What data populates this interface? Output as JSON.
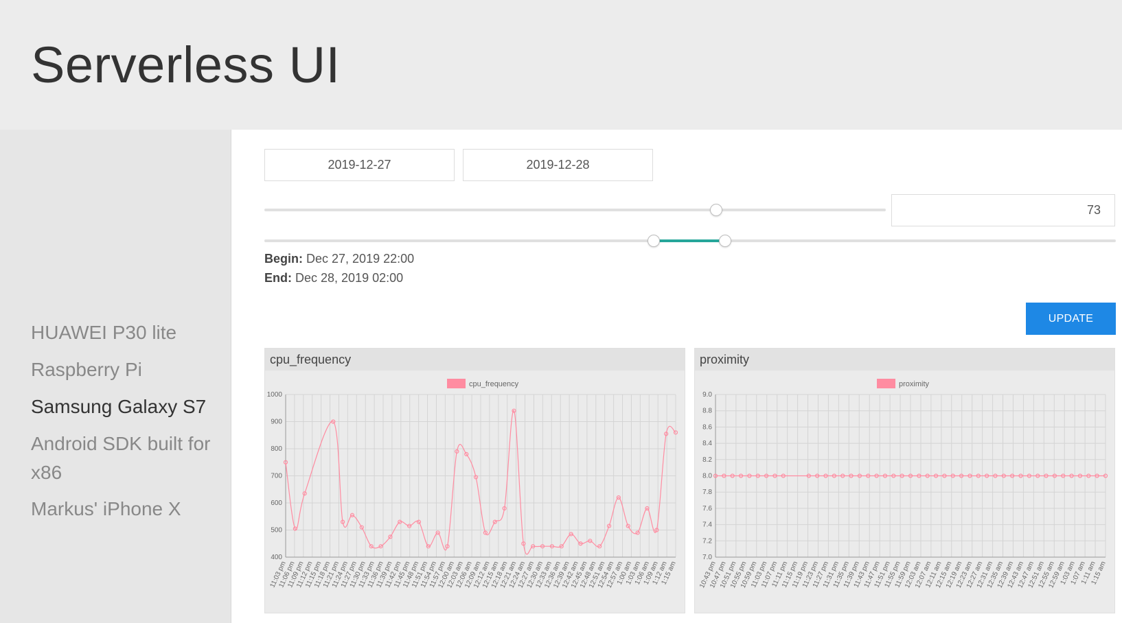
{
  "header": {
    "title": "Serverless UI"
  },
  "sidebar": {
    "items": [
      {
        "label": "HUAWEI P30 lite",
        "active": false
      },
      {
        "label": "Raspberry Pi",
        "active": false
      },
      {
        "label": "Samsung Galaxy S7",
        "active": true
      },
      {
        "label": "Android SDK built for x86",
        "active": false
      },
      {
        "label": "Markus' iPhone X",
        "active": false
      }
    ]
  },
  "controls": {
    "start_date": "2019-12-27",
    "end_date": "2019-12-28",
    "count_value": "73",
    "count_slider_fraction": 0.727,
    "range_slider": {
      "low_fraction": 0.457,
      "high_fraction": 0.541
    },
    "begin_label": "Begin:",
    "begin_value": "Dec 27, 2019 22:00",
    "end_label": "End:",
    "end_value": "Dec 28, 2019 02:00",
    "update_label": "UPDATE",
    "accent_color": "#26a69a",
    "button_color": "#1e88e5"
  },
  "chart_data": [
    {
      "type": "line",
      "title": "cpu_frequency",
      "legend": "cpu_frequency",
      "legend_position": "top-center",
      "color": "#ff8ca1",
      "grid": true,
      "ylim": [
        400,
        1000
      ],
      "yticks": [
        400,
        500,
        600,
        700,
        800,
        900,
        1000
      ],
      "categories": [
        "11:03 pm",
        "11:06 pm",
        "11:09 pm",
        "11:12 pm",
        "11:15 pm",
        "11:18 pm",
        "11:21 pm",
        "11:24 pm",
        "11:27 pm",
        "11:30 pm",
        "11:33 pm",
        "11:36 pm",
        "11:39 pm",
        "11:42 pm",
        "11:45 pm",
        "11:48 pm",
        "11:51 pm",
        "11:54 pm",
        "11:57 pm",
        "12:00 am",
        "12:03 am",
        "12:06 am",
        "12:09 am",
        "12:12 am",
        "12:15 am",
        "12:18 am",
        "12:21 am",
        "12:24 am",
        "12:27 am",
        "12:30 am",
        "12:33 am",
        "12:36 am",
        "12:39 am",
        "12:42 am",
        "12:45 am",
        "12:48 am",
        "12:51 am",
        "12:54 am",
        "12:57 am",
        "1:00 am",
        "1:03 am",
        "1:06 am",
        "1:09 am",
        "1:12 am",
        "1:15 am"
      ],
      "values": [
        750,
        505,
        635,
        null,
        null,
        900,
        530,
        555,
        510,
        440,
        440,
        475,
        530,
        515,
        530,
        440,
        490,
        440,
        790,
        780,
        695,
        490,
        530,
        580,
        940,
        450,
        440,
        440,
        440,
        440,
        485,
        450,
        460,
        440,
        515,
        620,
        515,
        490,
        580,
        500,
        855,
        860
      ]
    },
    {
      "type": "line",
      "title": "proximity",
      "legend": "proximity",
      "legend_position": "top-center",
      "color": "#ff8ca1",
      "grid": true,
      "ylim": [
        7.0,
        9.0
      ],
      "yticks": [
        "7.0",
        "7.2",
        "7.4",
        "7.6",
        "7.8",
        "8.0",
        "8.2",
        "8.4",
        "8.6",
        "8.8",
        "9.0"
      ],
      "categories": [
        "10:43 pm",
        "10:47 pm",
        "10:51 pm",
        "10:55 pm",
        "10:59 pm",
        "11:03 pm",
        "11:07 pm",
        "11:11 pm",
        "11:15 pm",
        "11:19 pm",
        "11:23 pm",
        "11:27 pm",
        "11:31 pm",
        "11:35 pm",
        "11:39 pm",
        "11:43 pm",
        "11:47 pm",
        "11:51 pm",
        "11:55 pm",
        "11:59 pm",
        "12:03 am",
        "12:07 am",
        "12:11 am",
        "12:15 am",
        "12:19 am",
        "12:23 am",
        "12:27 am",
        "12:31 am",
        "12:35 am",
        "12:39 am",
        "12:43 am",
        "12:47 am",
        "12:51 am",
        "12:55 am",
        "12:59 am",
        "1:03 am",
        "1:07 am",
        "1:11 am",
        "1:15 am"
      ],
      "values_constant": 8.0,
      "point_count": 47
    }
  ]
}
